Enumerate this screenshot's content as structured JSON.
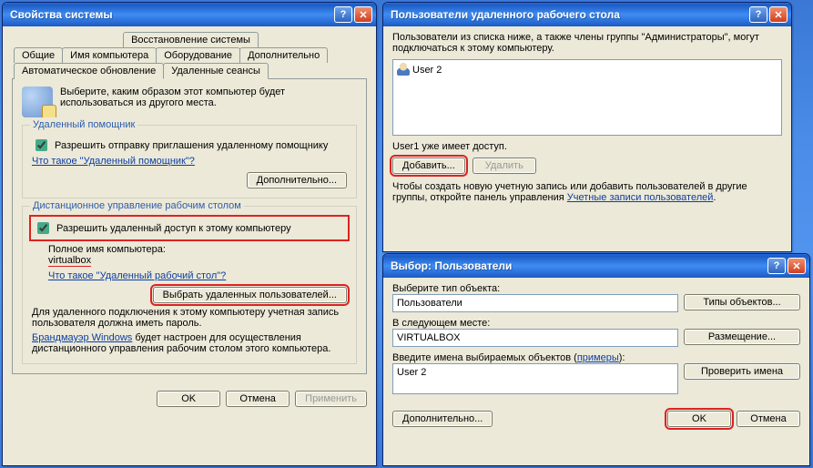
{
  "win1": {
    "title": "Свойства системы",
    "tabs": {
      "restore": "Восстановление системы",
      "general": "Общие",
      "name": "Имя компьютера",
      "hardware": "Оборудование",
      "advanced": "Дополнительно",
      "auto": "Автоматическое обновление",
      "remote": "Удаленные сеансы"
    },
    "intro": "Выберите, каким образом этот компьютер будет использоваться из другого места.",
    "assist": {
      "legend": "Удаленный помощник",
      "check": "Разрешить отправку приглашения удаленному помощнику",
      "link": "Что такое \"Удаленный помощник\"?",
      "adv": "Дополнительно..."
    },
    "rd": {
      "legend": "Дистанционное управление рабочим столом",
      "check": "Разрешить удаленный доступ к этому компьютеру",
      "fullname_label": "Полное имя компьютера:",
      "fullname": "virtualbox",
      "link": "Что такое \"Удаленный рабочий стол\"?",
      "select": "Выбрать удаленных пользователей...",
      "note1": "Для удаленного подключения к этому компьютеру учетная запись пользователя должна иметь пароль.",
      "fw1": "Брандмауэр Windows",
      "note2a": " будет настроен для осуществления дистанционного управления рабочим столом этого компьютера."
    },
    "ok": "OK",
    "cancel": "Отмена",
    "apply": "Применить"
  },
  "win2": {
    "title": "Пользователи удаленного рабочего стола",
    "intro": "Пользователи из списка ниже, а также члены группы \"Администраторы\", могут подключаться к этому компьютеру.",
    "user_item": "User 2",
    "already": "User1 уже имеет доступ.",
    "add": "Добавить...",
    "remove": "Удалить",
    "hint_pre": "Чтобы создать новую учетную запись или добавить пользователей в другие группы, откройте панель управления ",
    "hint_link": "Учетные записи пользователей",
    "hint_post": "."
  },
  "win3": {
    "title": "Выбор: Пользователи",
    "typeLabel": "Выберите тип объекта:",
    "typeVal": "Пользователи",
    "typeBtn": "Типы объектов...",
    "locLabel": "В следующем месте:",
    "locVal": "VIRTUALBOX",
    "locBtn": "Размещение...",
    "namesLabel_a": "Введите имена выбираемых объектов (",
    "namesLabel_link": "примеры",
    "namesLabel_b": "):",
    "namesVal": "User 2",
    "checkBtn": "Проверить имена",
    "adv": "Дополнительно...",
    "ok": "OK",
    "cancel": "Отмена"
  }
}
